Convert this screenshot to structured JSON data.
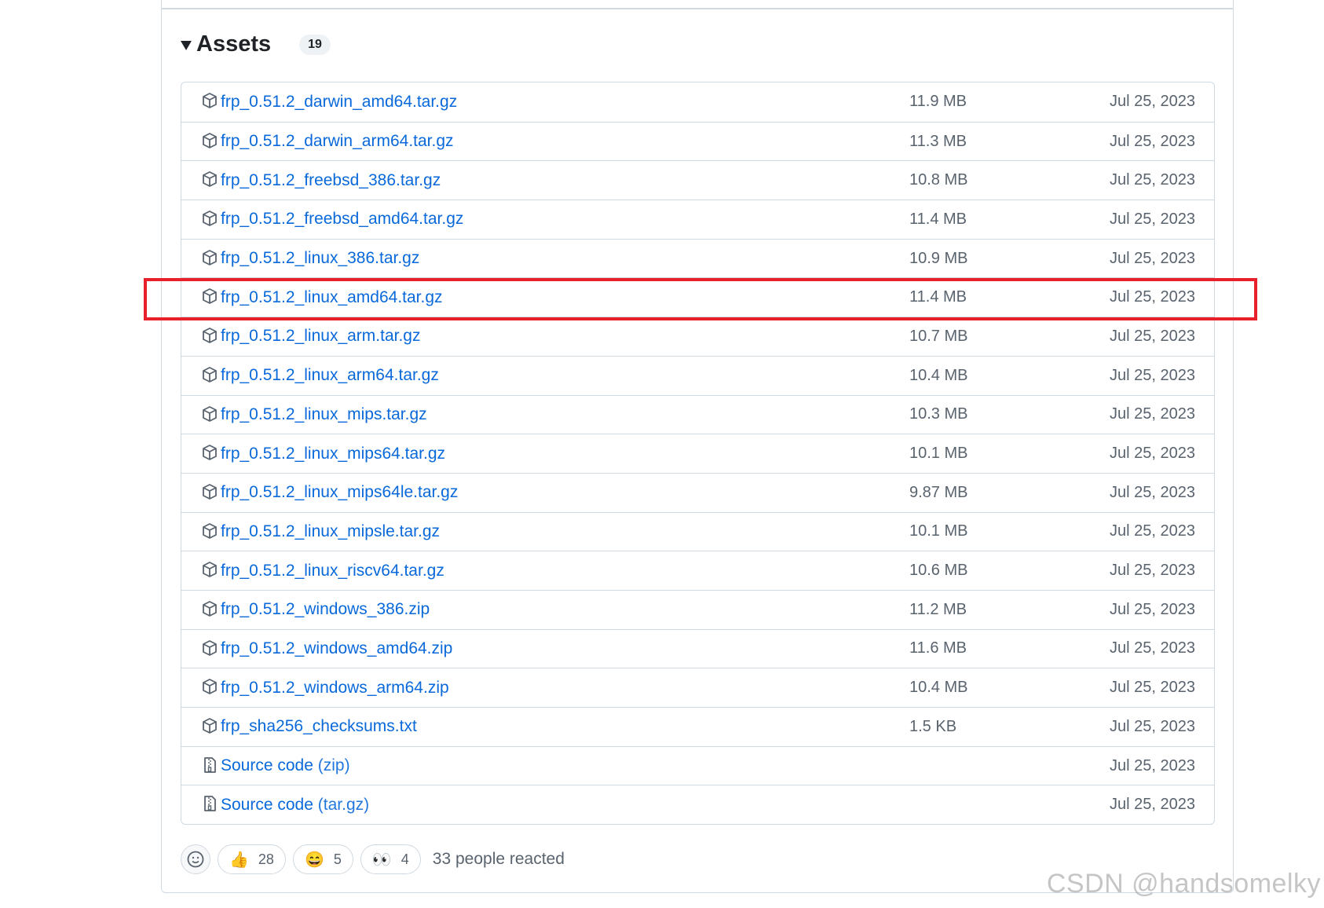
{
  "assets": {
    "title": "Assets",
    "count": "19",
    "items": [
      {
        "name": "frp_0.51.2_darwin_amd64.tar.gz",
        "size": "11.9 MB",
        "date": "Jul 25, 2023",
        "icon": "package-icon"
      },
      {
        "name": "frp_0.51.2_darwin_arm64.tar.gz",
        "size": "11.3 MB",
        "date": "Jul 25, 2023",
        "icon": "package-icon"
      },
      {
        "name": "frp_0.51.2_freebsd_386.tar.gz",
        "size": "10.8 MB",
        "date": "Jul 25, 2023",
        "icon": "package-icon"
      },
      {
        "name": "frp_0.51.2_freebsd_amd64.tar.gz",
        "size": "11.4 MB",
        "date": "Jul 25, 2023",
        "icon": "package-icon"
      },
      {
        "name": "frp_0.51.2_linux_386.tar.gz",
        "size": "10.9 MB",
        "date": "Jul 25, 2023",
        "icon": "package-icon"
      },
      {
        "name": "frp_0.51.2_linux_amd64.tar.gz",
        "size": "11.4 MB",
        "date": "Jul 25, 2023",
        "icon": "package-icon"
      },
      {
        "name": "frp_0.51.2_linux_arm.tar.gz",
        "size": "10.7 MB",
        "date": "Jul 25, 2023",
        "icon": "package-icon"
      },
      {
        "name": "frp_0.51.2_linux_arm64.tar.gz",
        "size": "10.4 MB",
        "date": "Jul 25, 2023",
        "icon": "package-icon"
      },
      {
        "name": "frp_0.51.2_linux_mips.tar.gz",
        "size": "10.3 MB",
        "date": "Jul 25, 2023",
        "icon": "package-icon"
      },
      {
        "name": "frp_0.51.2_linux_mips64.tar.gz",
        "size": "10.1 MB",
        "date": "Jul 25, 2023",
        "icon": "package-icon"
      },
      {
        "name": "frp_0.51.2_linux_mips64le.tar.gz",
        "size": "9.87 MB",
        "date": "Jul 25, 2023",
        "icon": "package-icon"
      },
      {
        "name": "frp_0.51.2_linux_mipsle.tar.gz",
        "size": "10.1 MB",
        "date": "Jul 25, 2023",
        "icon": "package-icon"
      },
      {
        "name": "frp_0.51.2_linux_riscv64.tar.gz",
        "size": "10.6 MB",
        "date": "Jul 25, 2023",
        "icon": "package-icon"
      },
      {
        "name": "frp_0.51.2_windows_386.zip",
        "size": "11.2 MB",
        "date": "Jul 25, 2023",
        "icon": "package-icon"
      },
      {
        "name": "frp_0.51.2_windows_amd64.zip",
        "size": "11.6 MB",
        "date": "Jul 25, 2023",
        "icon": "package-icon"
      },
      {
        "name": "frp_0.51.2_windows_arm64.zip",
        "size": "10.4 MB",
        "date": "Jul 25, 2023",
        "icon": "package-icon"
      },
      {
        "name": "frp_sha256_checksums.txt",
        "size": "1.5 KB",
        "date": "Jul 25, 2023",
        "icon": "package-icon"
      },
      {
        "name": "Source code",
        "suffix": "(zip)",
        "size": "",
        "date": "Jul 25, 2023",
        "icon": "file-zip-icon"
      },
      {
        "name": "Source code",
        "suffix": "(tar.gz)",
        "size": "",
        "date": "Jul 25, 2023",
        "icon": "file-zip-icon"
      }
    ],
    "highlighted_index": 5,
    "highlight_color": "#e8202a"
  },
  "reactions": {
    "items": [
      {
        "emoji": "👍",
        "count": "28",
        "name": "thumbs-up"
      },
      {
        "emoji": "😄",
        "count": "5",
        "name": "smile"
      },
      {
        "emoji": "👀",
        "count": "4",
        "name": "eyes"
      }
    ],
    "summary": "33 people reacted"
  },
  "watermark": "CSDN @handsomelky",
  "colors": {
    "link": "#0969da",
    "muted": "#59636e",
    "border": "#d1d9e0"
  }
}
